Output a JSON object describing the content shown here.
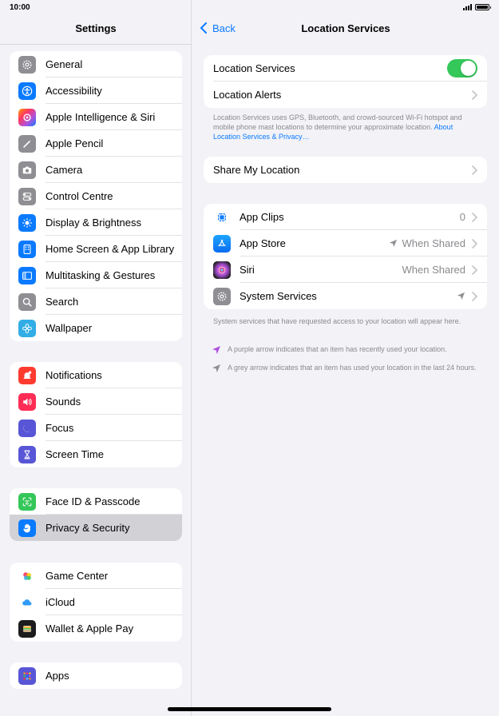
{
  "status": {
    "time": "10:00"
  },
  "sidebar": {
    "title": "Settings",
    "groups": [
      [
        {
          "label": "General",
          "icon": "gear-icon",
          "color": "#8e8e93"
        },
        {
          "label": "Accessibility",
          "icon": "accessibility-icon",
          "color": "#0a7aff"
        },
        {
          "label": "Apple Intelligence & Siri",
          "icon": "apple-intelligence-icon",
          "color": "#ff7a5c"
        },
        {
          "label": "Apple Pencil",
          "icon": "pencil-icon",
          "color": "#8e8e93"
        },
        {
          "label": "Camera",
          "icon": "camera-icon",
          "color": "#8e8e93"
        },
        {
          "label": "Control Centre",
          "icon": "control-centre-icon",
          "color": "#8e8e93"
        },
        {
          "label": "Display & Brightness",
          "icon": "sun-icon",
          "color": "#0a7aff"
        },
        {
          "label": "Home Screen & App Library",
          "icon": "home-screen-icon",
          "color": "#0a7aff"
        },
        {
          "label": "Multitasking & Gestures",
          "icon": "multitasking-icon",
          "color": "#0a7aff"
        },
        {
          "label": "Search",
          "icon": "search-icon",
          "color": "#8e8e93"
        },
        {
          "label": "Wallpaper",
          "icon": "flower-icon",
          "color": "#32ade6"
        }
      ],
      [
        {
          "label": "Notifications",
          "icon": "bell-icon",
          "color": "#ff3b30"
        },
        {
          "label": "Sounds",
          "icon": "speaker-icon",
          "color": "#ff2d55"
        },
        {
          "label": "Focus",
          "icon": "moon-icon",
          "color": "#5856d6"
        },
        {
          "label": "Screen Time",
          "icon": "hourglass-icon",
          "color": "#5856d6"
        }
      ],
      [
        {
          "label": "Face ID & Passcode",
          "icon": "face-id-icon",
          "color": "#34c759"
        },
        {
          "label": "Privacy & Security",
          "icon": "hand-icon",
          "color": "#0a7aff",
          "selected": true
        }
      ],
      [
        {
          "label": "Game Center",
          "icon": "game-center-icon",
          "color": "#ffffff"
        },
        {
          "label": "iCloud",
          "icon": "cloud-icon",
          "color": "#ffffff"
        },
        {
          "label": "Wallet & Apple Pay",
          "icon": "wallet-icon",
          "color": "#1c1c1e"
        }
      ],
      [
        {
          "label": "Apps",
          "icon": "apps-grid-icon",
          "color": "#5856d6"
        }
      ]
    ]
  },
  "detail": {
    "back_label": "Back",
    "title": "Location Services",
    "location_services_label": "Location Services",
    "location_services_on": true,
    "location_alerts_label": "Location Alerts",
    "footnote_text": "Location Services uses GPS, Bluetooth, and crowd-sourced Wi-Fi hotspot and mobile phone mast locations to determine your approximate location.",
    "footnote_link": "About Location Services & Privacy…",
    "share_location_label": "Share My Location",
    "apps": [
      {
        "label": "App Clips",
        "value": "0",
        "icon": "app-clips-icon",
        "arrow": false
      },
      {
        "label": "App Store",
        "value": "When Shared",
        "icon": "app-store-icon",
        "arrow": true
      },
      {
        "label": "Siri",
        "value": "When Shared",
        "icon": "siri-icon",
        "arrow": false
      },
      {
        "label": "System Services",
        "value": "",
        "icon": "system-services-icon",
        "arrow": true
      }
    ],
    "system_note": "System services that have requested access to your location will appear here.",
    "legend_purple": "A purple arrow indicates that an item has recently used your location.",
    "legend_grey": "A grey arrow indicates that an item has used your location in the last 24 hours."
  },
  "colors": {
    "accent": "#0a7aff",
    "toggle_on": "#34c759",
    "purple_arrow": "#af52de",
    "grey_arrow": "#8e8e93"
  }
}
